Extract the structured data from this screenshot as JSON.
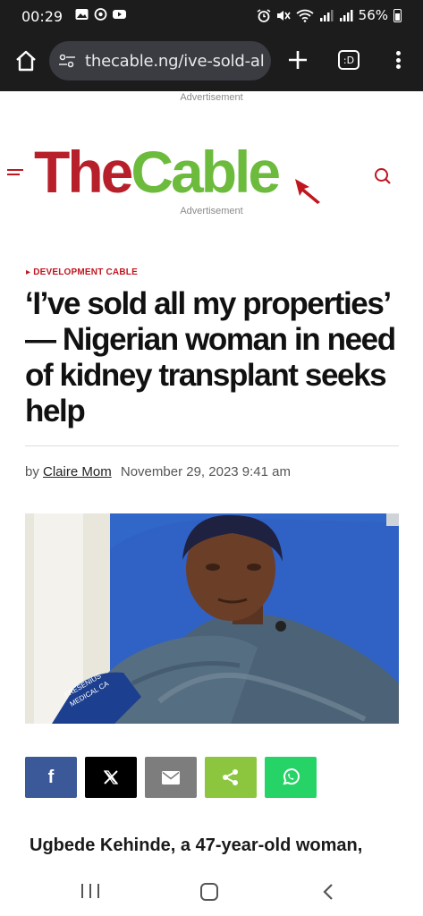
{
  "status_bar": {
    "time": "00:29",
    "battery_percent": "56%",
    "left_icons": [
      "gallery-icon",
      "whatsapp-icon",
      "youtube-icon"
    ],
    "right_icons": [
      "alarm-icon",
      "mute-icon",
      "wifi-icon",
      "signal-icon",
      "signal-icon",
      "battery-icon"
    ]
  },
  "browser": {
    "url": "thecable.ng/ive-sold-al",
    "tab_label": ":D"
  },
  "site": {
    "ad_label_top": "Advertisement",
    "ad_label_mid": "Advertisement",
    "logo_part1": "The",
    "logo_part2": "Cable",
    "brand_red": "#b7202a",
    "brand_green": "#6dbb3d"
  },
  "article": {
    "category": "▸ DEVELOPMENT CABLE",
    "headline": "‘I’ve sold all my properties’ — Nigerian woman in need of kidney transplant seeks help",
    "byline_prefix": "by",
    "author": "Claire Mom",
    "date": "November 29, 2023 9:41 am",
    "lead_text": "Ugbede Kehinde, a 47-year-old woman,"
  },
  "photo": {
    "arm_label_line1": "FRESENIUS",
    "arm_label_line2": "MEDICAL CA"
  },
  "share_buttons": [
    {
      "name": "facebook",
      "glyph": "f",
      "color": "#3b5998"
    },
    {
      "name": "x",
      "glyph": "𝕏",
      "color": "#000000"
    },
    {
      "name": "email",
      "glyph": "",
      "color": "#7d7d7d"
    },
    {
      "name": "share",
      "glyph": "",
      "color": "#8cc63f"
    },
    {
      "name": "whatsapp",
      "glyph": "",
      "color": "#25d366"
    }
  ]
}
